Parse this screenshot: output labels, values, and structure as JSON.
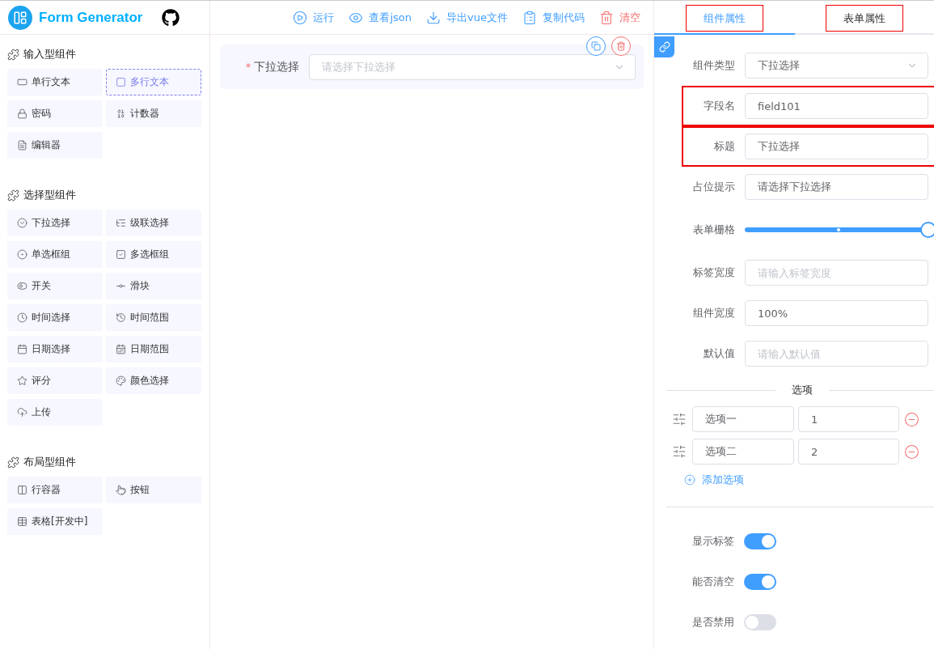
{
  "header": {
    "title": "Form Generator"
  },
  "toolbar": [
    {
      "label": "运行",
      "kind": "run"
    },
    {
      "label": "查看json",
      "kind": "view"
    },
    {
      "label": "导出vue文件",
      "kind": "export"
    },
    {
      "label": "复制代码",
      "kind": "copy"
    },
    {
      "label": "清空",
      "kind": "clear"
    }
  ],
  "palette": [
    {
      "title": "输入型组件",
      "items": [
        {
          "label": "单行文本",
          "selected": false
        },
        {
          "label": "多行文本",
          "selected": true
        },
        {
          "label": "密码",
          "selected": false
        },
        {
          "label": "计数器",
          "selected": false
        },
        {
          "label": "编辑器",
          "selected": false
        }
      ]
    },
    {
      "title": "选择型组件",
      "items": [
        {
          "label": "下拉选择",
          "selected": false
        },
        {
          "label": "级联选择",
          "selected": false
        },
        {
          "label": "单选框组",
          "selected": false
        },
        {
          "label": "多选框组",
          "selected": false
        },
        {
          "label": "开关",
          "selected": false
        },
        {
          "label": "滑块",
          "selected": false
        },
        {
          "label": "时间选择",
          "selected": false
        },
        {
          "label": "时间范围",
          "selected": false
        },
        {
          "label": "日期选择",
          "selected": false
        },
        {
          "label": "日期范围",
          "selected": false
        },
        {
          "label": "评分",
          "selected": false
        },
        {
          "label": "颜色选择",
          "selected": false
        },
        {
          "label": "上传",
          "selected": false
        }
      ]
    },
    {
      "title": "布局型组件",
      "items": [
        {
          "label": "行容器",
          "selected": false
        },
        {
          "label": "按钮",
          "selected": false
        },
        {
          "label": "表格[开发中]",
          "selected": false
        }
      ]
    }
  ],
  "canvas": {
    "fields": [
      {
        "required_mark": "*",
        "label": "下拉选择",
        "placeholder": "请选择下拉选择",
        "selected": true
      }
    ]
  },
  "properties": {
    "tabs": [
      {
        "label": "组件属性",
        "selected": true,
        "highlighted": true
      },
      {
        "label": "表单属性",
        "selected": false,
        "highlighted": true
      }
    ],
    "rows": [
      {
        "kind": "select",
        "label": "组件类型",
        "value": "下拉选择",
        "highlighted": false
      },
      {
        "kind": "input",
        "label": "字段名",
        "value": "field101",
        "highlighted": true
      },
      {
        "kind": "input",
        "label": "标题",
        "value": "下拉选择",
        "highlighted": true
      },
      {
        "kind": "input",
        "label": "占位提示",
        "value": "请选择下拉选择",
        "highlighted": false
      },
      {
        "kind": "slider",
        "label": "表单栅格",
        "level": 1,
        "highlighted": false
      },
      {
        "kind": "input",
        "label": "标签宽度",
        "placeholder": "请输入标签宽度",
        "highlighted": false
      },
      {
        "kind": "input",
        "label": "组件宽度",
        "value": "100%",
        "highlighted": false
      },
      {
        "kind": "input",
        "label": "默认值",
        "placeholder": "请输入默认值",
        "highlighted": false
      }
    ],
    "options_title": "选项",
    "options": [
      {
        "label": "选项一",
        "value": "1"
      },
      {
        "label": "选项二",
        "value": "2"
      }
    ],
    "add_option": "添加选项",
    "switches": [
      {
        "label": "显示标签",
        "on": true
      },
      {
        "label": "能否清空",
        "on": true
      },
      {
        "label": "是否禁用",
        "on": false
      }
    ]
  }
}
